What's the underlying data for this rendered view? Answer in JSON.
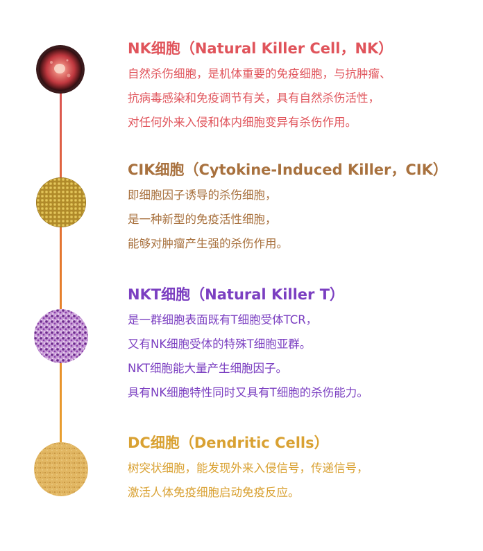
{
  "sections": [
    {
      "title": "NK细胞（Natural Killer Cell，NK）",
      "lines": [
        "自然杀伤细胞，是机体重要的免疫细胞，与抗肿瘤、",
        "抗病毒感染和免疫调节有关，具有自然杀伤活性，",
        "对任何外来入侵和体内细胞变异有杀伤作用。"
      ]
    },
    {
      "title": "CIK细胞（Cytokine-Induced Killer，CIK）",
      "lines": [
        "即细胞因子诱导的杀伤细胞，",
        "是一种新型的免疫活性细胞，",
        "能够对肿瘤产生强的杀伤作用。"
      ]
    },
    {
      "title": "NKT细胞（Natural Killer T）",
      "lines": [
        "是一群细胞表面既有T细胞受体TCR，",
        "又有NK细胞受体的特殊T细胞亚群。",
        "NKT细胞能大量产生细胞因子。",
        "具有NK细胞特性同时又具有T细胞的杀伤能力。"
      ]
    },
    {
      "title": "DC细胞（Dendritic Cells）",
      "lines": [
        "树突状细胞，能发现外来入侵信号，传递信号，",
        "激活人体免疫细胞启动免疫反应。"
      ]
    }
  ],
  "colors": {
    "nk": "#e0545b",
    "cik": "#a8713e",
    "nkt": "#7b3fc1",
    "dc": "#d9a132"
  },
  "icons": [
    "nk-cell-image",
    "cik-cell-image",
    "nkt-cell-image",
    "dc-cell-image"
  ]
}
